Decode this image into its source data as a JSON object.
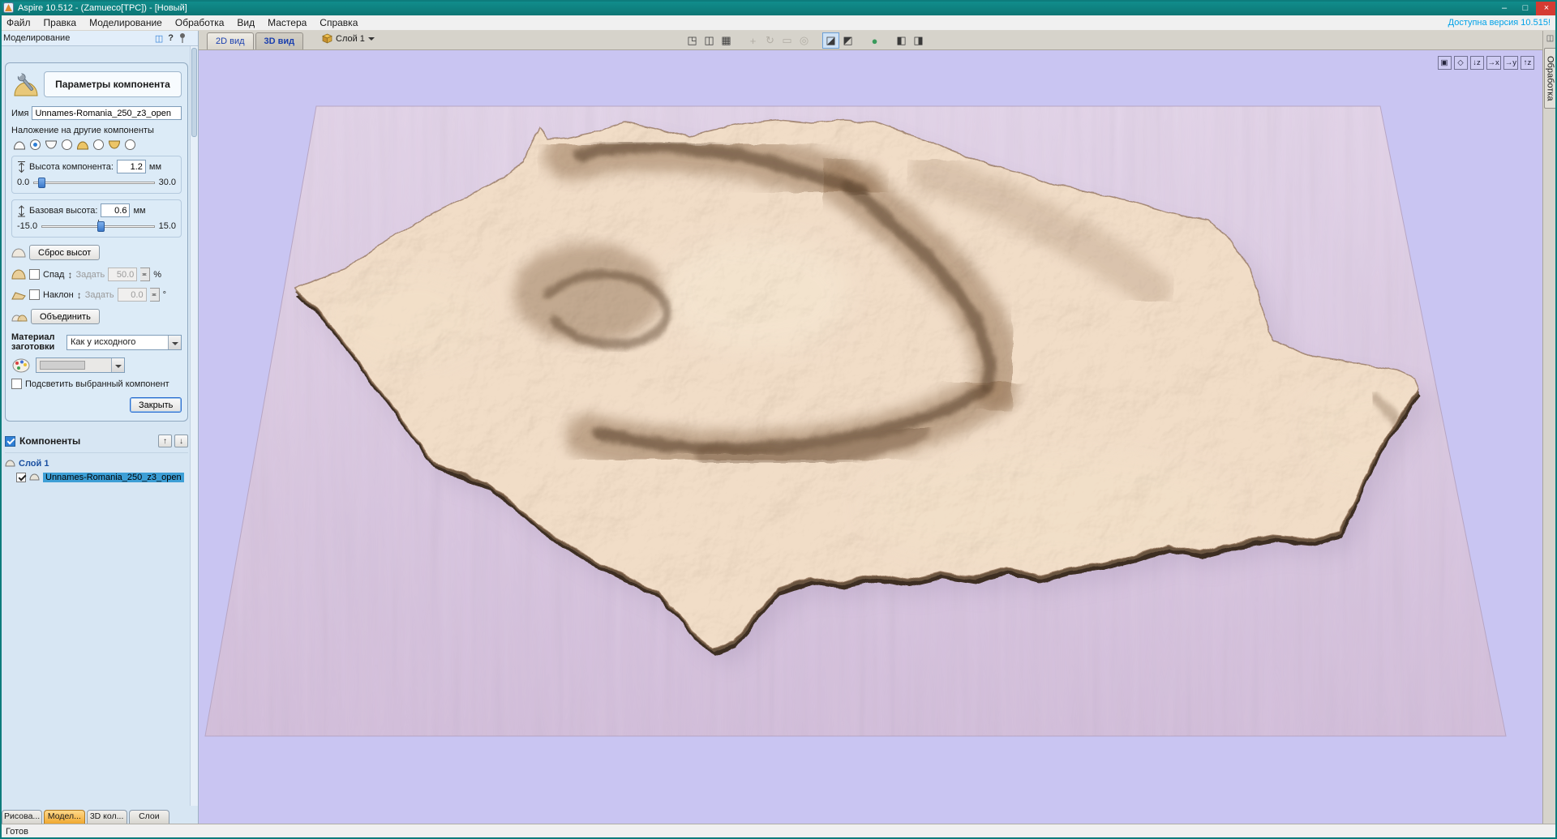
{
  "window": {
    "title": "Aspire 10.512 - (Zamueco[TPC]) - [Новый]",
    "icons": {
      "minimize": "–",
      "maximize": "□",
      "close": "×"
    }
  },
  "menu": {
    "items": [
      "Файл",
      "Правка",
      "Моделирование",
      "Обработка",
      "Вид",
      "Мастера",
      "Справка"
    ],
    "update_notice": "Доступна версия 10.515!"
  },
  "panel": {
    "header": {
      "title": "Моделирование",
      "help": "?"
    },
    "params": {
      "title": "Параметры компонента",
      "name_label": "Имя",
      "name_value": "Unnames-Romania_250_z3_open",
      "combine_label": "Наложение на другие компоненты",
      "height": {
        "label": "Высота компонента:",
        "value": "1.2",
        "unit": "мм",
        "min": "0.0",
        "max": "30.0"
      },
      "base": {
        "label": "Базовая высота:",
        "value": "0.6",
        "unit": "мм",
        "min": "-15.0",
        "max": "15.0"
      },
      "reset_button": "Сброс высот",
      "fade": {
        "label": "Спад",
        "set_label": "Задать",
        "value": "50.0",
        "unit": "%"
      },
      "tilt": {
        "label": "Наклон",
        "set_label": "Задать",
        "value": "0.0",
        "unit": "°"
      },
      "merge_button": "Объединить",
      "material_label": "Материал заготовки",
      "material_value": "Как у исходного",
      "highlight_label": "Подсветить выбранный компонент",
      "close_button": "Закрыть"
    },
    "components": {
      "title": "Компоненты",
      "items": [
        {
          "label": "Слой 1"
        },
        {
          "label": "Unnames-Romania_250_z3_open"
        }
      ]
    },
    "tabs": [
      "Рисова...",
      "Модел...",
      "3D кол...",
      "Слои"
    ]
  },
  "viewport": {
    "tabs": [
      "2D вид",
      "3D вид"
    ],
    "layer": "Слой 1",
    "toolbar": [
      {
        "name": "snap-planes",
        "glyph": "◳"
      },
      {
        "name": "multi-view",
        "glyph": "◫"
      },
      {
        "name": "grid",
        "glyph": "▦"
      },
      {
        "name": "pan",
        "glyph": "+"
      },
      {
        "name": "rotate-view",
        "glyph": "↻"
      },
      {
        "name": "zoom-box",
        "glyph": "▭"
      },
      {
        "name": "zoom",
        "glyph": "◎"
      },
      {
        "name": "shaded-view",
        "glyph": "◪"
      },
      {
        "name": "wireframe-view",
        "glyph": "◩"
      },
      {
        "name": "orbit-3d",
        "glyph": "●"
      },
      {
        "name": "split-view-h",
        "glyph": "◧"
      },
      {
        "name": "split-view-v",
        "glyph": "◨"
      }
    ],
    "nav": [
      {
        "name": "zoom-extents",
        "glyph": "▣"
      },
      {
        "name": "iso-view",
        "glyph": "◇"
      },
      {
        "name": "view-top",
        "glyph": "↓z"
      },
      {
        "name": "view-front",
        "glyph": "→x"
      },
      {
        "name": "view-side",
        "glyph": "→y"
      },
      {
        "name": "view-bottom",
        "glyph": "↑z"
      }
    ],
    "right_tab": "Обработка"
  },
  "status": {
    "text": "Готов"
  },
  "colors": {
    "accent": "#2f7fd6",
    "titlebar": "#0d7c7c",
    "canvas_bg": "#c9c5f2",
    "terrain": "#e8c8a6"
  }
}
